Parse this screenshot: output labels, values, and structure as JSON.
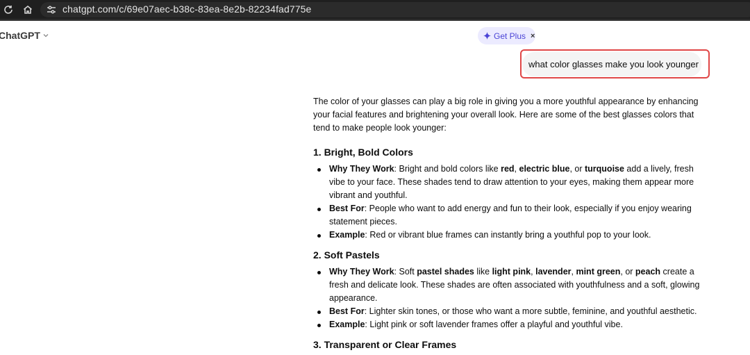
{
  "browser": {
    "url": "chatgpt.com/c/69e07aec-b38c-83ea-8e2b-82234fad775e"
  },
  "header": {
    "model_label": "ChatGPT",
    "get_plus_label": "Get Plus",
    "get_plus_close": "×"
  },
  "user_message": "what color glasses make you look younger",
  "reply": {
    "intro": "The color of your glasses can play a big role in giving you a more youthful appearance by enhancing your facial features and brightening your overall look. Here are some of the best glasses colors that tend to make people look younger:",
    "sections": [
      {
        "heading": "1. Bright, Bold Colors",
        "items": [
          {
            "label": "Why They Work",
            "parts": [
              ": Bright and bold colors like ",
              "red",
              ", ",
              "electric blue",
              ", or ",
              "turquoise",
              " add a lively, fresh vibe to your face. These shades tend to draw attention to your eyes, making them appear more vibrant and youthful."
            ]
          },
          {
            "label": "Best For",
            "text": ": People who want to add energy and fun to their look, especially if you enjoy wearing statement pieces."
          },
          {
            "label": "Example",
            "text": ": Red or vibrant blue frames can instantly bring a youthful pop to your look."
          }
        ]
      },
      {
        "heading": "2. Soft Pastels",
        "items": [
          {
            "label": "Why They Work",
            "parts": [
              ": Soft ",
              "pastel shades",
              " like ",
              "light pink",
              ", ",
              "lavender",
              ", ",
              "mint green",
              ", or ",
              "peach",
              " create a fresh and delicate look. These shades are often associated with youthfulness and a soft, glowing appearance."
            ]
          },
          {
            "label": "Best For",
            "text": ": Lighter skin tones, or those who want a more subtle, feminine, and youthful aesthetic."
          },
          {
            "label": "Example",
            "text": ": Light pink or soft lavender frames offer a playful and youthful vibe."
          }
        ]
      },
      {
        "heading": "3. Transparent or Clear Frames"
      }
    ]
  },
  "colors": {
    "browser_bg": "#1f1f1f",
    "accent_purple": "#4b44d6",
    "highlight_red": "#e04646",
    "bubble_bg": "#f4f4f4"
  },
  "icons": [
    "reload-icon",
    "home-icon",
    "site-settings-icon",
    "chevron-down-icon",
    "sparkle-icon",
    "close-icon"
  ]
}
